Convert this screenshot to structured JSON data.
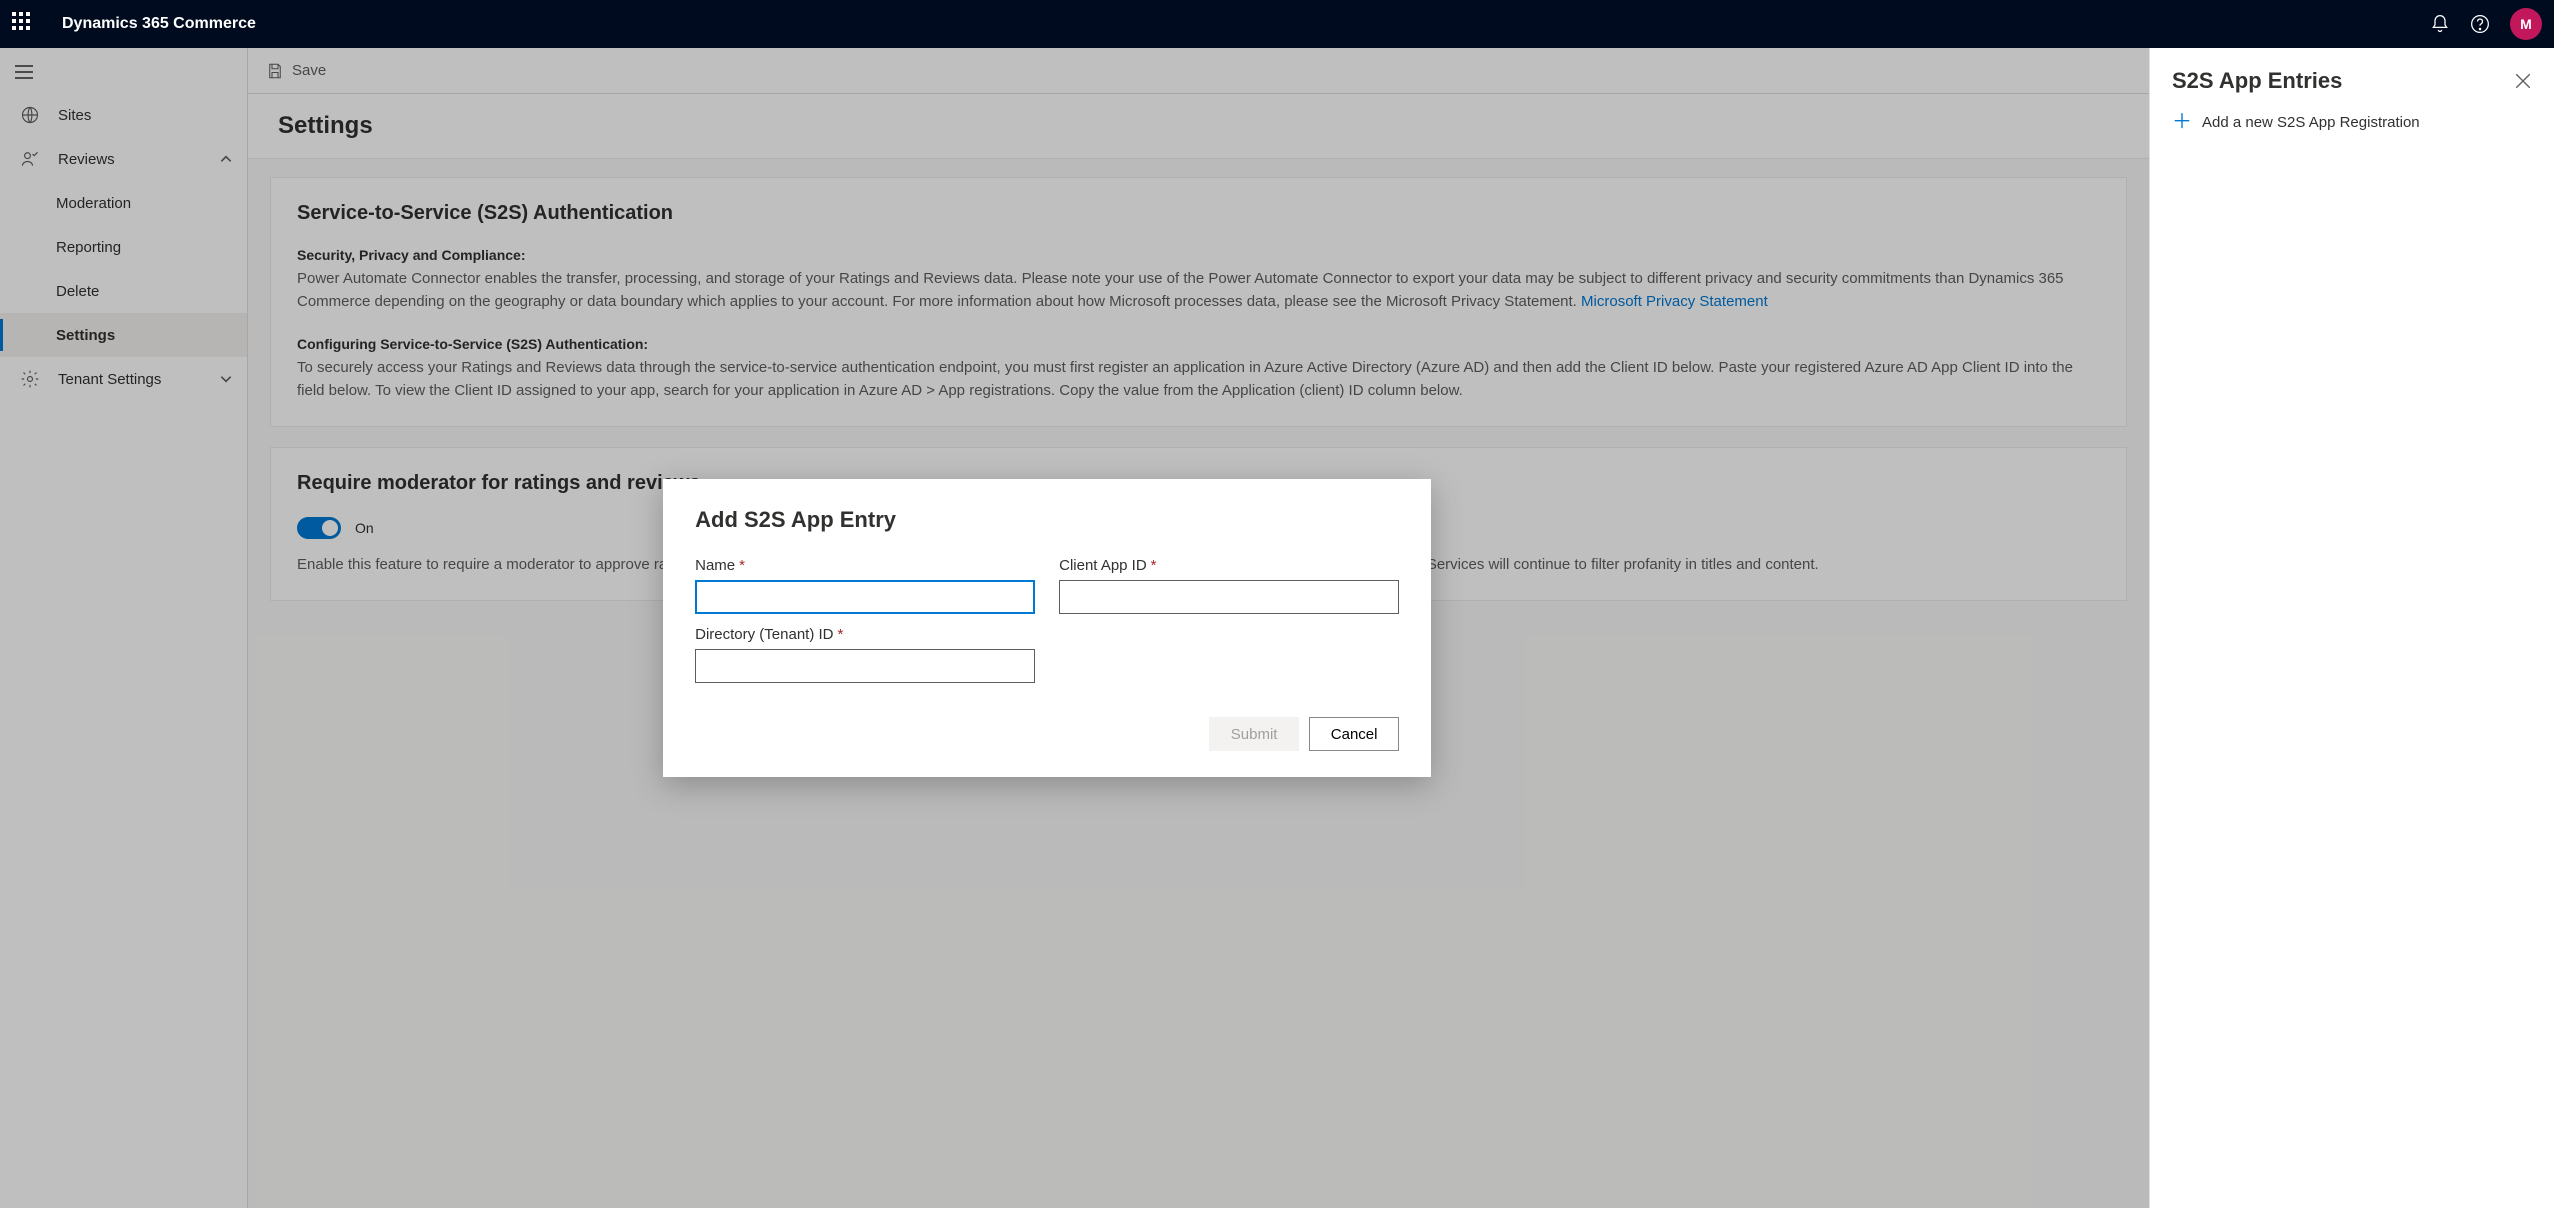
{
  "topbar": {
    "app_name": "Dynamics 365 Commerce",
    "avatar_initial": "M"
  },
  "sidebar": {
    "items": [
      {
        "label": "Sites"
      },
      {
        "label": "Reviews"
      },
      {
        "label": "Moderation"
      },
      {
        "label": "Reporting"
      },
      {
        "label": "Delete"
      },
      {
        "label": "Settings"
      },
      {
        "label": "Tenant Settings"
      }
    ]
  },
  "commandbar": {
    "save_label": "Save"
  },
  "page": {
    "heading": "Settings"
  },
  "card_s2s": {
    "title": "Service-to-Service (S2S) Authentication",
    "subhead1": "Security, Privacy and Compliance:",
    "p1": "Power Automate Connector enables the transfer, processing, and storage of your Ratings and Reviews data. Please note your use of the Power Automate Connector to export your data may be subject to different privacy and security commitments than Dynamics 365 Commerce depending on the geography or data boundary which applies to your account. For more information about how Microsoft processes data, please see the Microsoft Privacy Statement. ",
    "link1": "Microsoft Privacy Statement",
    "subhead2": "Configuring Service-to-Service (S2S) Authentication:",
    "p2": "To securely access your Ratings and Reviews data through the service-to-service authentication endpoint, you must first register an application in Azure Active Directory (Azure AD) and then add the Client ID below. Paste your registered Azure AD App Client ID into the field below. To view the Client ID assigned to your app, search for your application in Azure AD > App registrations. Copy the value from the Application (client) ID column below."
  },
  "card_mod": {
    "title": "Require moderator for ratings and reviews",
    "toggle_label": "On",
    "p": "Enable this feature to require a moderator to approve ratings and reviews before publishing. Enabling this feature could prevent near real-time publishing. Azure Cognitive Services will continue to filter profanity in titles and content."
  },
  "flyout": {
    "title": "S2S App Entries",
    "add_label": "Add a new S2S App Registration"
  },
  "modal": {
    "title": "Add S2S App Entry",
    "name_label": "Name",
    "client_label": "Client App ID",
    "tenant_label": "Directory (Tenant) ID",
    "submit_label": "Submit",
    "cancel_label": "Cancel"
  }
}
